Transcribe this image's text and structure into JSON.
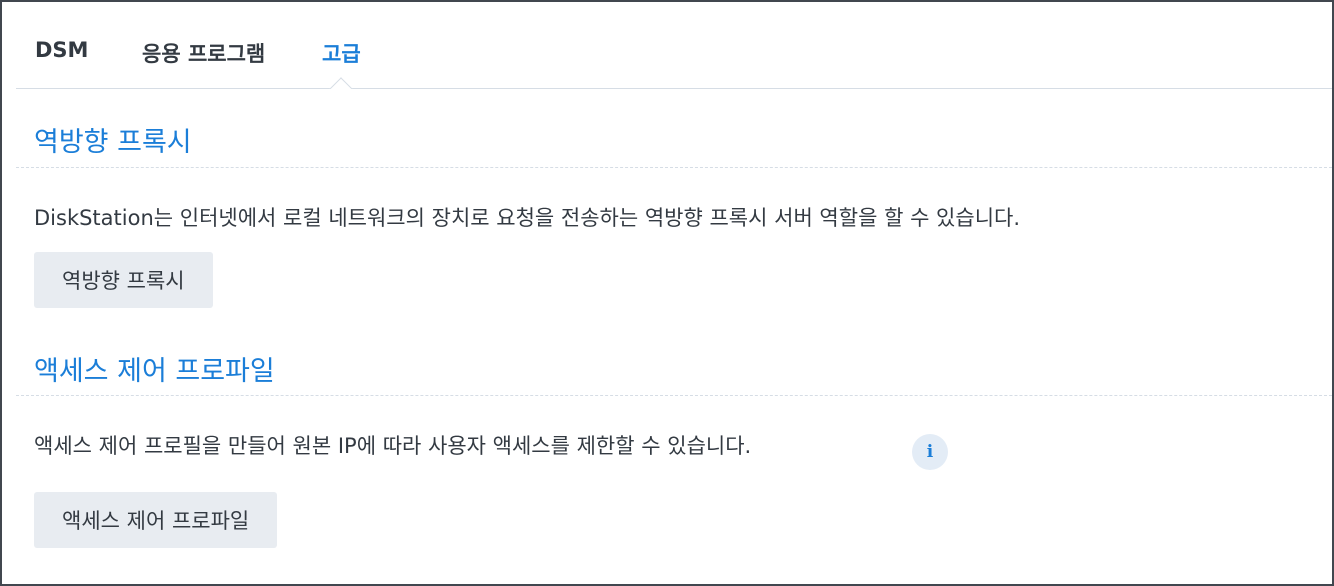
{
  "tabs": [
    {
      "label": "DSM"
    },
    {
      "label": "응용 프로그램"
    },
    {
      "label": "고급"
    }
  ],
  "active_tab": "고급",
  "reverse_proxy": {
    "title": "역방향 프록시",
    "description": "DiskStation는 인터넷에서 로컬 네트워크의 장치로 요청을 전송하는 역방향 프록시 서버 역할을 할 수 있습니다.",
    "button_label": "역방향 프록시"
  },
  "access_control": {
    "title": "액세스 제어 프로파일",
    "description": "액세스 제어 프로필을 만들어 원본 IP에 따라 사용자 액세스를 제한할 수 있습니다.",
    "info_icon": "info-icon",
    "info_glyph": "i",
    "button_label": "액세스 제어 프로파일"
  },
  "colors": {
    "accent": "#1b7ed8",
    "text": "#333a42",
    "button_bg": "#e8ecf1",
    "divider": "#d6dde5"
  }
}
